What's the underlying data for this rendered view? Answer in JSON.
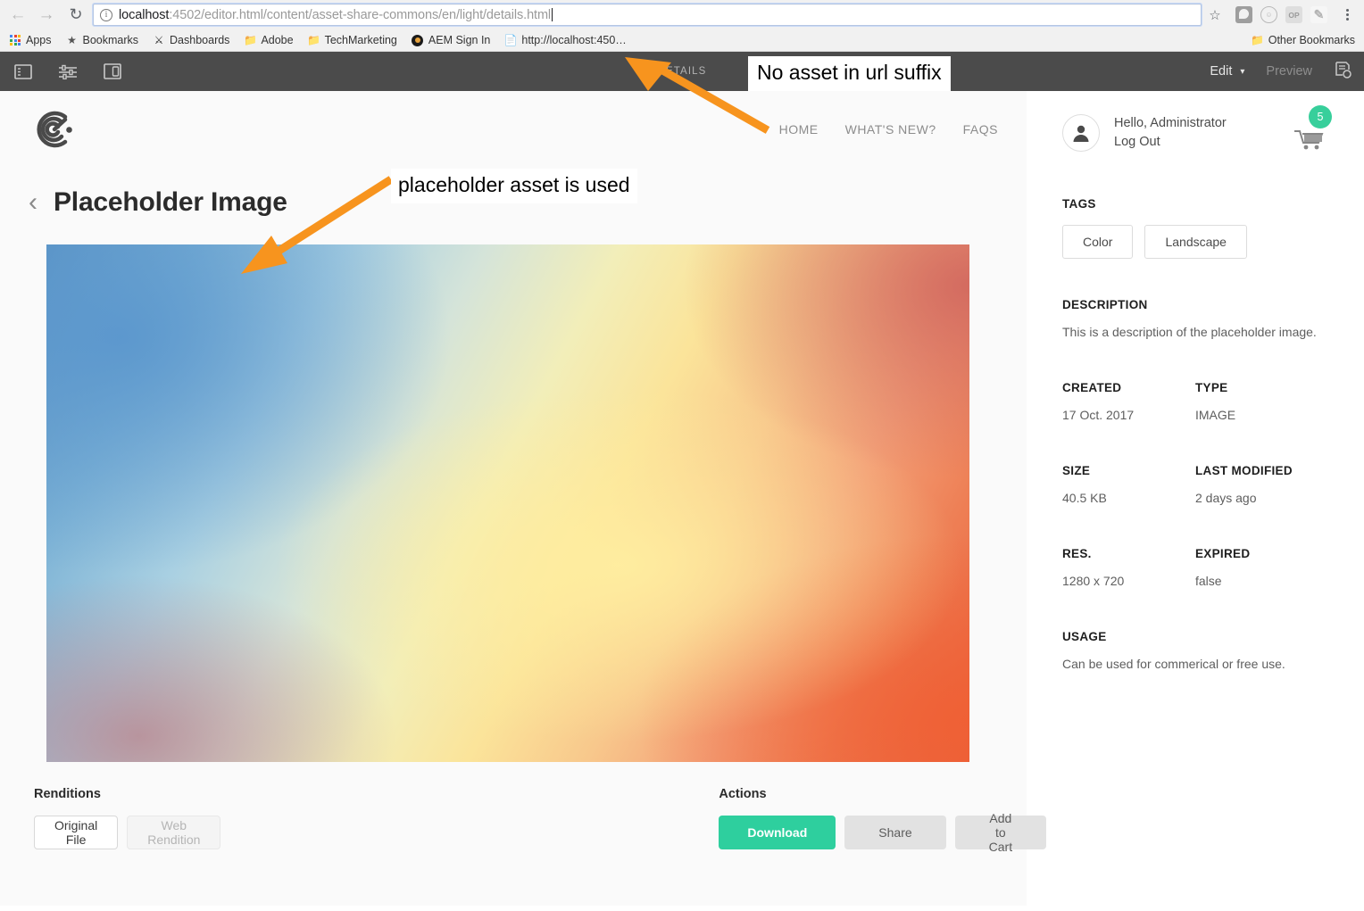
{
  "browser": {
    "back_icon": "back-arrow-icon",
    "forward_icon": "forward-arrow-icon",
    "reload_icon": "reload-icon",
    "info_glyph": "i",
    "url_host": "localhost",
    "url_rest": ":4502/editor.html/content/asset-share-commons/en/light/details.html",
    "url_full": "localhost:4502/editor.html/content/asset-share-commons/en/light/details.html",
    "star_glyph": "☆",
    "extensions": [
      "pocket-icon",
      "circle-icon",
      "op-icon",
      "pen-icon"
    ],
    "menu_icon": "kebab-menu-icon",
    "bookmarks": [
      {
        "label": "Apps",
        "icon": "apps-grid-icon"
      },
      {
        "label": "Bookmarks",
        "icon": "star-icon"
      },
      {
        "label": "Dashboards",
        "icon": "dashboards-icon"
      },
      {
        "label": "Adobe",
        "icon": "folder-icon"
      },
      {
        "label": "TechMarketing",
        "icon": "folder-icon"
      },
      {
        "label": "AEM Sign In",
        "icon": "aem-icon"
      },
      {
        "label": "http://localhost:450…",
        "icon": "document-icon"
      }
    ],
    "other_bookmarks": {
      "label": "Other Bookmarks",
      "icon": "folder-icon"
    }
  },
  "aem_bar": {
    "icons": [
      "side-panel-icon",
      "page-properties-icon",
      "emulator-icon"
    ],
    "center_label": "DETAILS",
    "edit_label": "Edit",
    "chevron": "▾",
    "preview_label": "Preview",
    "layout_icon": "annotate-icon"
  },
  "site": {
    "logo_name": "asset-share-commons-logo",
    "nav": [
      {
        "label": "HOME"
      },
      {
        "label": "WHAT'S NEW?"
      },
      {
        "label": "FAQS"
      }
    ]
  },
  "asset": {
    "back_chevron": "‹",
    "title": "Placeholder Image",
    "image_alt": "placeholder-gradient-image"
  },
  "renditions": {
    "label": "Renditions",
    "buttons": [
      {
        "label": "Original File",
        "state": "active"
      },
      {
        "label": "Web Rendition",
        "state": "disabled"
      }
    ]
  },
  "actions": {
    "label": "Actions",
    "buttons": [
      {
        "label": "Download",
        "style": "primary"
      },
      {
        "label": "Share",
        "style": "muted"
      },
      {
        "label": "Add to Cart",
        "style": "muted"
      }
    ]
  },
  "sidebar": {
    "user": {
      "greeting": "Hello, Administrator",
      "logout": "Log Out",
      "avatar_icon": "user-avatar-icon"
    },
    "cart": {
      "icon": "shopping-cart-icon",
      "count": "5"
    },
    "tags": {
      "label": "TAGS",
      "items": [
        "Color",
        "Landscape"
      ]
    },
    "description": {
      "label": "DESCRIPTION",
      "value": "This is a description of the placeholder image."
    },
    "meta": [
      {
        "label": "CREATED",
        "value": "17 Oct. 2017"
      },
      {
        "label": "TYPE",
        "value": "IMAGE"
      },
      {
        "label": "SIZE",
        "value": "40.5 KB"
      },
      {
        "label": "LAST MODIFIED",
        "value": "2 days ago"
      },
      {
        "label": "RES.",
        "value": "1280 x 720"
      },
      {
        "label": "EXPIRED",
        "value": "false"
      }
    ],
    "usage": {
      "label": "USAGE",
      "value": "Can be used for commerical or free use."
    }
  },
  "annotations": [
    {
      "text": "No asset in url suffix"
    },
    {
      "text": "placeholder asset is used"
    }
  ],
  "colors": {
    "accent_green": "#2ecf9e",
    "badge_green": "#37cf9b",
    "annotation_orange": "#f7941e",
    "aem_bar": "#4b4b4b"
  }
}
